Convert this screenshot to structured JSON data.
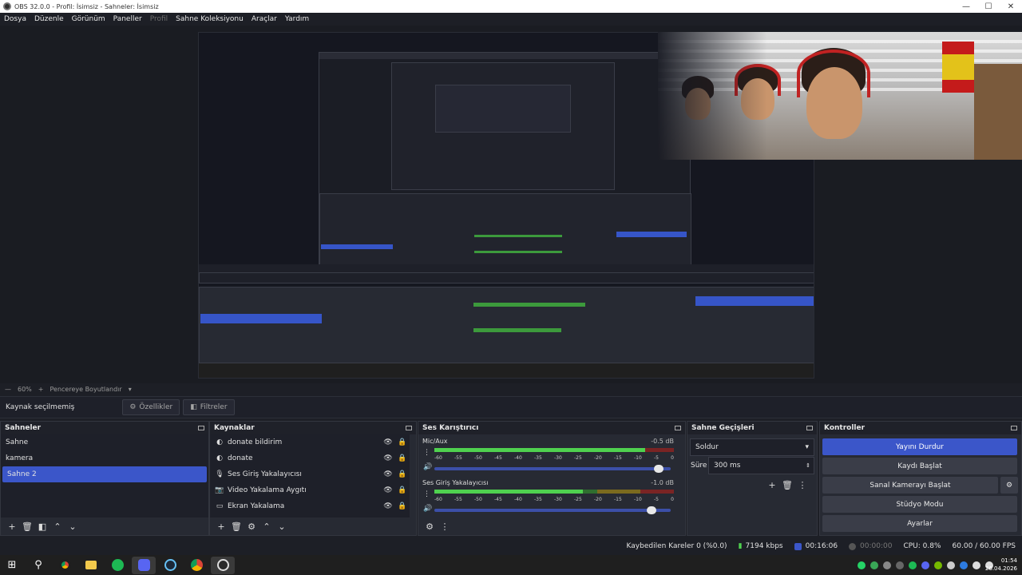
{
  "window": {
    "title": "OBS 32.0.0 - Profil: İsimsiz - Sahneler: İsimsiz",
    "minimize": "—",
    "maximize": "☐",
    "close": "✕"
  },
  "menu": [
    "Dosya",
    "Düzenle",
    "Görünüm",
    "Paneller",
    "Profil",
    "Sahne Koleksiyonu",
    "Araçlar",
    "Yardım"
  ],
  "zoom": {
    "value": "60%",
    "fit_label": "Pencereye Boyutlandır"
  },
  "context": {
    "no_source": "Kaynak seçilmemiş",
    "properties": "Özellikler",
    "filters": "Filtreler"
  },
  "scenes": {
    "title": "Sahneler",
    "items": [
      "Sahne",
      "kamera",
      "Sahne 2"
    ],
    "selected": "Sahne 2"
  },
  "sources": {
    "title": "Kaynaklar",
    "items": [
      {
        "name": "donate bildirim",
        "icon": "browser-icon"
      },
      {
        "name": "donate",
        "icon": "browser-icon"
      },
      {
        "name": "Ses Giriş Yakalayıcısı",
        "icon": "microphone-icon"
      },
      {
        "name": "Video Yakalama Aygıtı",
        "icon": "camera-icon"
      },
      {
        "name": "Ekran Yakalama",
        "icon": "monitor-icon"
      }
    ]
  },
  "mixer": {
    "title": "Ses Karıştırıcı",
    "channels": [
      {
        "name": "Mic/Aux",
        "db": "-0.5 dB",
        "level": 0.88,
        "volume": 0.95
      },
      {
        "name": "Ses Giriş Yakalayıcısı",
        "db": "-1.0 dB",
        "level": 0.62,
        "volume": 0.92
      }
    ],
    "ticks": [
      "-60",
      "-55",
      "-50",
      "-45",
      "-40",
      "-35",
      "-30",
      "-25",
      "-20",
      "-15",
      "-10",
      "-5",
      "0"
    ]
  },
  "transitions": {
    "title": "Sahne Geçişleri",
    "type": "Soldur",
    "duration_label": "Süre",
    "duration": "300 ms"
  },
  "controls": {
    "title": "Kontroller",
    "stop_stream": "Yayını Durdur",
    "start_record": "Kaydı Başlat",
    "virtual_cam": "Sanal Kamerayı Başlat",
    "studio_mode": "Stüdyo Modu",
    "settings": "Ayarlar"
  },
  "status": {
    "dropped": "Kaybedilen Kareler 0 (%0.0)",
    "bitrate": "7194 kbps",
    "stream_time": "00:16:06",
    "record_time": "00:00:00",
    "cpu": "CPU: 0.8%",
    "fps": "60.00 / 60.00 FPS"
  },
  "clock": {
    "time": "01:54",
    "date": "26.04.2026"
  },
  "colors": {
    "accent": "#3b56c9",
    "live_green": "#4fd14f"
  }
}
